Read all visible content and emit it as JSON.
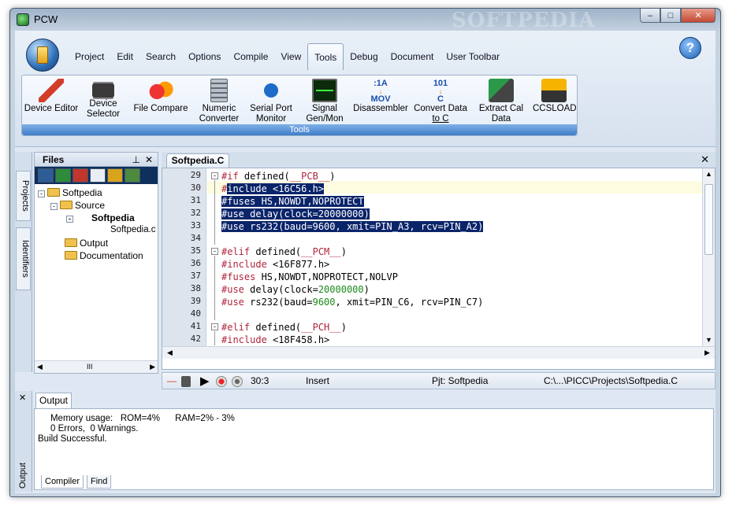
{
  "window": {
    "title": "PCW",
    "watermark": "SOFTPEDIA"
  },
  "titlebar": {
    "min_icon": "minimize-icon",
    "max_icon": "maximize-icon",
    "close_icon": "close-icon",
    "min": "–",
    "max": "□",
    "close": "✕"
  },
  "menu": {
    "items": [
      "Project",
      "Edit",
      "Search",
      "Options",
      "Compile",
      "View",
      "Tools",
      "Debug",
      "Document",
      "User Toolbar"
    ],
    "active": "Tools",
    "help": "?"
  },
  "tools": {
    "footer": "Tools",
    "items": [
      {
        "label1": "Device Editor",
        "label2": "",
        "icon": "pen-icon"
      },
      {
        "label1": "Device",
        "label2": "Selector",
        "icon": "chip-icon"
      },
      {
        "label1": "File Compare",
        "label2": "",
        "icon": "fruit-icon"
      },
      {
        "label1": "Numeric",
        "label2": "Converter",
        "icon": "calculator-icon"
      },
      {
        "label1": "Serial Port",
        "label2": "Monitor",
        "icon": "serial-port-icon"
      },
      {
        "label1": "Signal",
        "label2": "Gen/Mon",
        "icon": "oscilloscope-icon"
      },
      {
        "label1": "Disassembler",
        "label2": "",
        "icon": "disassembler-icon"
      },
      {
        "label1": "Convert Data",
        "label2": "to C",
        "icon": "convert-icon"
      },
      {
        "label1": "Extract Cal",
        "label2": "Data",
        "icon": "extract-icon"
      },
      {
        "label1": "CCSLOAD",
        "label2": "",
        "icon": "ccsload-icon"
      }
    ],
    "icon_text": {
      "disasm_top": ":1A",
      "disasm_bottom": "MOV",
      "convert_top": "101",
      "convert_bottom": "C"
    }
  },
  "side_tabs": {
    "projects": "Projects",
    "identifiers": "Identifiers"
  },
  "files": {
    "title": "Files",
    "pin": "⊥",
    "close": "✕",
    "tree": [
      {
        "label": "Softpedia",
        "bold": false
      },
      {
        "label": "Source",
        "bold": false
      },
      {
        "label": "Softpedia",
        "bold": true
      },
      {
        "label": "Softpedia.c",
        "bold": false
      },
      {
        "label": "Output",
        "bold": false
      },
      {
        "label": "Documentation",
        "bold": false
      }
    ],
    "expanders": [
      "-",
      "-",
      "-"
    ],
    "hscroll_thumb": "III"
  },
  "editor": {
    "tab": "Softpedia.C",
    "close": "✕",
    "lines": [
      {
        "n": "29",
        "fold": "-"
      },
      {
        "n": "30",
        "fold": ""
      },
      {
        "n": "31",
        "fold": ""
      },
      {
        "n": "32",
        "fold": ""
      },
      {
        "n": "33",
        "fold": ""
      },
      {
        "n": "34",
        "fold": ""
      },
      {
        "n": "35",
        "fold": "-"
      },
      {
        "n": "36",
        "fold": ""
      },
      {
        "n": "37",
        "fold": ""
      },
      {
        "n": "38",
        "fold": ""
      },
      {
        "n": "39",
        "fold": ""
      },
      {
        "n": "40",
        "fold": ""
      },
      {
        "n": "41",
        "fold": "-"
      },
      {
        "n": "42",
        "fold": ""
      }
    ],
    "code": {
      "l29a": "#if",
      "l29b": " defined(",
      "l29c": "__PCB__",
      "l29d": ")",
      "l30a": "#",
      "l30b": "include <16C56.h>",
      "l31": "#fuses HS,NOWDT,NOPROTECT",
      "l32": "#use delay(clock=20000000)",
      "l33": "#use rs232(baud=9600, xmit=PIN_A3, rcv=PIN_A2)",
      "l35a": "#elif",
      "l35b": " defined(",
      "l35c": "__PCM__",
      "l35d": ")",
      "l36a": "#include",
      "l36b": " <16F877.h>",
      "l37a": "#fuses",
      "l37b": " HS,NOWDT,NOPROTECT,NOLVP",
      "l38a": "#use",
      "l38b": " delay(clock=",
      "l38c": "20000000",
      "l38d": ")",
      "l39a": "#use",
      "l39b": " rs232(baud=",
      "l39c": "9600",
      "l39d": ", xmit=PIN_C6, rcv=PIN_C7)",
      "l41a": "#elif",
      "l41b": " defined(",
      "l41c": "__PCH__",
      "l41d": ")",
      "l42a": "#include",
      "l42b": " <18F458.h>"
    },
    "colors": {
      "keyword": "#b0243a",
      "number": "#1b8a1b",
      "selection": "#0a246a"
    }
  },
  "status": {
    "position": "30:3",
    "mode": "Insert",
    "project": "Pjt: Softpedia",
    "path": "C:\\...\\PICC\\Projects\\Softpedia.C"
  },
  "output": {
    "strip_label": "Output",
    "tab": "Output",
    "close": "✕",
    "lines": [
      "     Memory usage:   ROM=4%      RAM=2% - 3%",
      "     0 Errors,  0 Warnings.",
      "Build Successful."
    ],
    "subtabs": [
      "Compiler",
      "Find"
    ]
  }
}
